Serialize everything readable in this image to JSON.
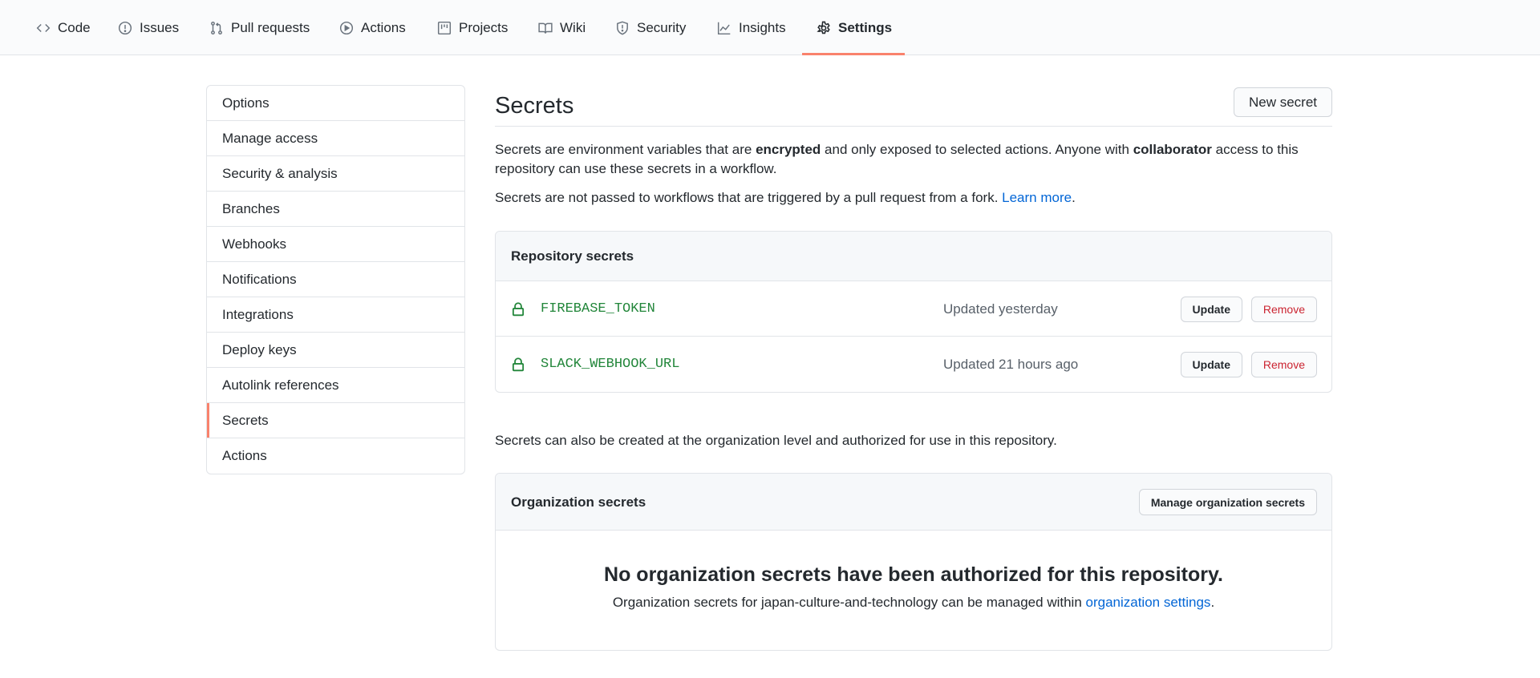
{
  "nav": {
    "tabs": [
      {
        "label": "Code",
        "icon": "code-icon"
      },
      {
        "label": "Issues",
        "icon": "issue-icon"
      },
      {
        "label": "Pull requests",
        "icon": "pull-request-icon"
      },
      {
        "label": "Actions",
        "icon": "play-icon"
      },
      {
        "label": "Projects",
        "icon": "project-icon"
      },
      {
        "label": "Wiki",
        "icon": "book-icon"
      },
      {
        "label": "Security",
        "icon": "shield-icon"
      },
      {
        "label": "Insights",
        "icon": "graph-icon"
      },
      {
        "label": "Settings",
        "icon": "gear-icon",
        "active": true
      }
    ],
    "active_color": "#f9826c"
  },
  "sidebar": {
    "items": [
      {
        "label": "Options"
      },
      {
        "label": "Manage access"
      },
      {
        "label": "Security & analysis"
      },
      {
        "label": "Branches"
      },
      {
        "label": "Webhooks"
      },
      {
        "label": "Notifications"
      },
      {
        "label": "Integrations"
      },
      {
        "label": "Deploy keys"
      },
      {
        "label": "Autolink references"
      },
      {
        "label": "Secrets",
        "active": true
      },
      {
        "label": "Actions"
      }
    ]
  },
  "main": {
    "title": "Secrets",
    "new_secret_label": "New secret",
    "intro": {
      "part1": "Secrets are environment variables that are ",
      "bold1": "encrypted",
      "part2": " and only exposed to selected actions. Anyone with ",
      "bold2": "collaborator",
      "part3": " access to this repository can use these secrets in a workflow."
    },
    "fork_note": {
      "text": "Secrets are not passed to workflows that are triggered by a pull request from a fork. ",
      "link": "Learn more",
      "end": "."
    },
    "repository_secrets": {
      "header": "Repository secrets",
      "rows": [
        {
          "name": "FIREBASE_TOKEN",
          "updated": "Updated yesterday",
          "update_label": "Update",
          "remove_label": "Remove"
        },
        {
          "name": "SLACK_WEBHOOK_URL",
          "updated": "Updated 21 hours ago",
          "update_label": "Update",
          "remove_label": "Remove"
        }
      ]
    },
    "org_note": "Secrets can also be created at the organization level and authorized for use in this repository.",
    "organization_secrets": {
      "header": "Organization secrets",
      "manage_label": "Manage organization secrets",
      "blank_title": "No organization secrets have been authorized for this repository.",
      "blank_text": "Organization secrets for japan-culture-and-technology can be managed within ",
      "blank_link": "organization settings",
      "blank_end": "."
    }
  },
  "colors": {
    "secret_name": "#22863a",
    "remove": "#cb2431",
    "link": "#0366d6"
  }
}
